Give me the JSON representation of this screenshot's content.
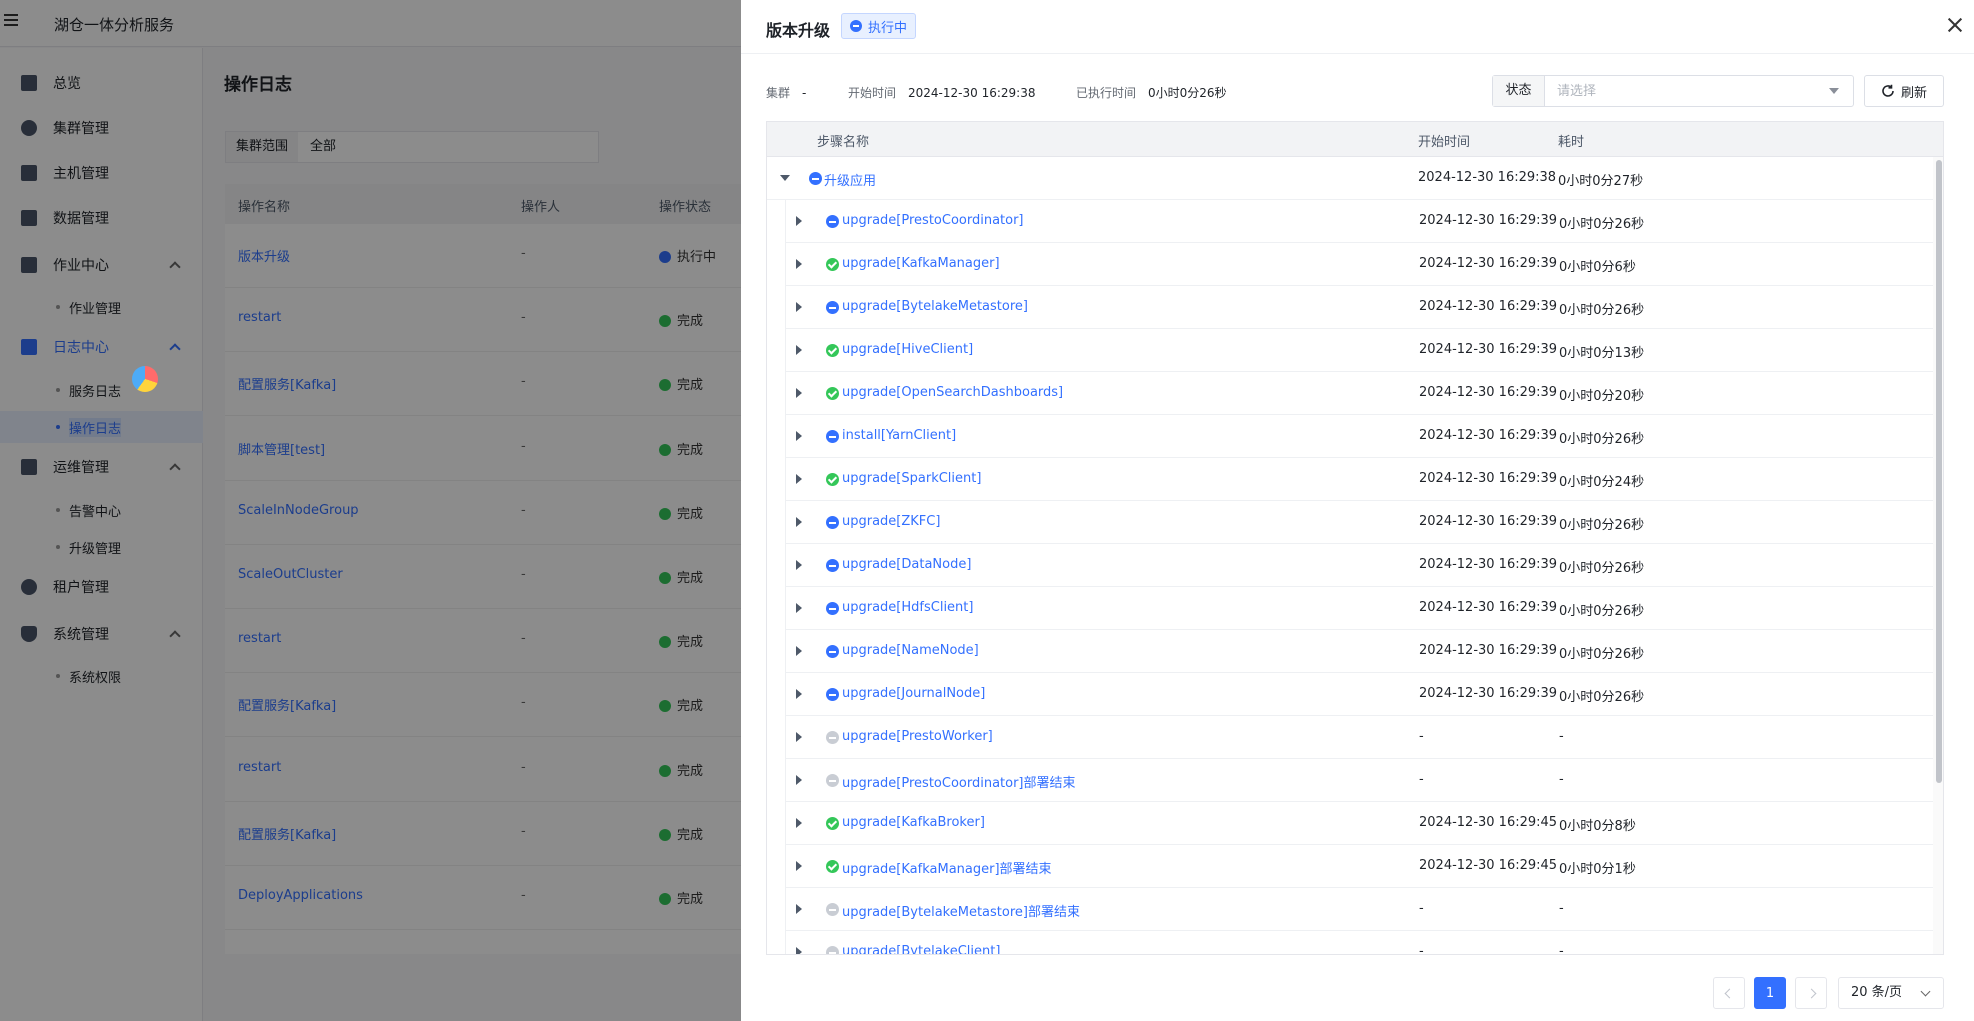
{
  "app": {
    "title": "湖仓一体分析服务"
  },
  "sidebar": {
    "items": [
      {
        "label": "总览"
      },
      {
        "label": "集群管理"
      },
      {
        "label": "主机管理"
      },
      {
        "label": "数据管理"
      },
      {
        "label": "作业中心"
      },
      {
        "label": "作业管理"
      },
      {
        "label": "日志中心"
      },
      {
        "label": "服务日志"
      },
      {
        "label": "操作日志"
      },
      {
        "label": "运维管理"
      },
      {
        "label": "告警中心"
      },
      {
        "label": "升级管理"
      },
      {
        "label": "租户管理"
      },
      {
        "label": "系统管理"
      },
      {
        "label": "系统权限"
      }
    ]
  },
  "page": {
    "title": "操作日志",
    "filter_label": "集群范围",
    "filter_value": "全部",
    "columns": [
      "操作名称",
      "操作人",
      "操作状态"
    ],
    "rows": [
      {
        "name": "版本升级",
        "operator": "-",
        "status": "执行中"
      },
      {
        "name": "restart",
        "operator": "-",
        "status": "完成"
      },
      {
        "name": "配置服务[Kafka]",
        "operator": "-",
        "status": "完成"
      },
      {
        "name": "脚本管理[test]",
        "operator": "-",
        "status": "完成"
      },
      {
        "name": "ScaleInNodeGroup",
        "operator": "-",
        "status": "完成"
      },
      {
        "name": "ScaleOutCluster",
        "operator": "-",
        "status": "完成"
      },
      {
        "name": "restart",
        "operator": "-",
        "status": "完成"
      },
      {
        "name": "配置服务[Kafka]",
        "operator": "-",
        "status": "完成"
      },
      {
        "name": "restart",
        "operator": "-",
        "status": "完成"
      },
      {
        "name": "配置服务[Kafka]",
        "operator": "-",
        "status": "完成"
      },
      {
        "name": "DeployApplications",
        "operator": "-",
        "status": "完成"
      }
    ]
  },
  "drawer": {
    "title": "版本升级",
    "status_tag": "执行中",
    "meta": {
      "cluster_label": "集群",
      "cluster_value": "-",
      "start_label": "开始时间",
      "start_value": "2024-12-30 16:29:38",
      "elapsed_label": "已执行时间",
      "elapsed_value": "0小时0分26秒"
    },
    "status_filter": {
      "label": "状态",
      "placeholder": "请选择"
    },
    "refresh_label": "刷新",
    "columns": {
      "name": "步骤名称",
      "start": "开始时间",
      "duration": "耗时"
    },
    "parent": {
      "name": "升级应用",
      "status": "running",
      "start": "2024-12-30 16:29:38",
      "duration": "0小时0分27秒"
    },
    "steps": [
      {
        "name": "upgrade[PrestoCoordinator]",
        "status": "running",
        "start": "2024-12-30 16:29:39",
        "duration": "0小时0分26秒"
      },
      {
        "name": "upgrade[KafkaManager]",
        "status": "done",
        "start": "2024-12-30 16:29:39",
        "duration": "0小时0分6秒"
      },
      {
        "name": "upgrade[BytelakeMetastore]",
        "status": "running",
        "start": "2024-12-30 16:29:39",
        "duration": "0小时0分26秒"
      },
      {
        "name": "upgrade[HiveClient]",
        "status": "done",
        "start": "2024-12-30 16:29:39",
        "duration": "0小时0分13秒"
      },
      {
        "name": "upgrade[OpenSearchDashboards]",
        "status": "done",
        "start": "2024-12-30 16:29:39",
        "duration": "0小时0分20秒"
      },
      {
        "name": "install[YarnClient]",
        "status": "running",
        "start": "2024-12-30 16:29:39",
        "duration": "0小时0分26秒"
      },
      {
        "name": "upgrade[SparkClient]",
        "status": "done",
        "start": "2024-12-30 16:29:39",
        "duration": "0小时0分24秒"
      },
      {
        "name": "upgrade[ZKFC]",
        "status": "running",
        "start": "2024-12-30 16:29:39",
        "duration": "0小时0分26秒"
      },
      {
        "name": "upgrade[DataNode]",
        "status": "running",
        "start": "2024-12-30 16:29:39",
        "duration": "0小时0分26秒"
      },
      {
        "name": "upgrade[HdfsClient]",
        "status": "running",
        "start": "2024-12-30 16:29:39",
        "duration": "0小时0分26秒"
      },
      {
        "name": "upgrade[NameNode]",
        "status": "running",
        "start": "2024-12-30 16:29:39",
        "duration": "0小时0分26秒"
      },
      {
        "name": "upgrade[JournalNode]",
        "status": "running",
        "start": "2024-12-30 16:29:39",
        "duration": "0小时0分26秒"
      },
      {
        "name": "upgrade[PrestoWorker]",
        "status": "pending",
        "start": "-",
        "duration": "-"
      },
      {
        "name": "upgrade[PrestoCoordinator]部署结束",
        "status": "pending",
        "start": "-",
        "duration": "-"
      },
      {
        "name": "upgrade[KafkaBroker]",
        "status": "done",
        "start": "2024-12-30 16:29:45",
        "duration": "0小时0分8秒"
      },
      {
        "name": "upgrade[KafkaManager]部署结束",
        "status": "done",
        "start": "2024-12-30 16:29:45",
        "duration": "0小时0分1秒"
      },
      {
        "name": "upgrade[BytelakeMetastore]部署结束",
        "status": "pending",
        "start": "-",
        "duration": "-"
      },
      {
        "name": "upgrade[BytelakeClient]",
        "status": "pending",
        "start": "-",
        "duration": "-"
      }
    ],
    "pagination": {
      "current": "1",
      "page_size": "20 条/页"
    }
  },
  "colors": {
    "accent": "#3370ff",
    "success": "#34c759",
    "pending": "#c9cdd4"
  }
}
